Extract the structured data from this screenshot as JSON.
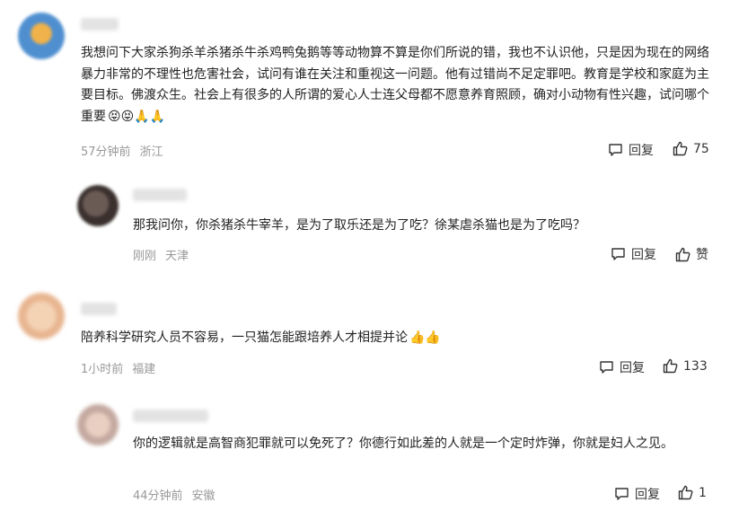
{
  "comments": [
    {
      "text": "我想问下大家杀狗杀羊杀猪杀牛杀鸡鸭兔鹅等等动物算不算是你们所说的错，我也不认识他，只是因为现在的网络暴力非常的不理性也危害社会，试问有谁在关注和重视这一问题。他有过错尚不足定罪吧。教育是学校和家庭为主要目标。佛渡众生。社会上有很多的人所谓的爱心人士连父母都不愿意养育照顾，确对小动物有性兴趣，试问哪个重要",
      "emojis": "😝😝🙏🙏",
      "time": "57分钟前",
      "location": "浙江",
      "reply_label": "回复",
      "like_count": "75"
    },
    {
      "text": "那我问你，你杀猪杀牛宰羊，是为了取乐还是为了吃？徐某虐杀猫也是为了吃吗？",
      "emojis": "",
      "time": "刚刚",
      "location": "天津",
      "reply_label": "回复",
      "like_count": "赞"
    },
    {
      "text": "陪养科学研究人员不容易，一只猫怎能跟培养人才相提并论",
      "emojis": "👍👍",
      "time": "1小时前",
      "location": "福建",
      "reply_label": "回复",
      "like_count": "133"
    },
    {
      "text": "你的逻辑就是高智商犯罪就可以免死了？你德行如此差的人就是一个定时炸弹，你就是妇人之见。",
      "emojis": "",
      "time": "44分钟前",
      "location": "安徽",
      "reply_label": "回复",
      "like_count": "1"
    }
  ],
  "colors": {
    "meta": "#999999",
    "text": "#222222",
    "background": "#ffffff"
  }
}
